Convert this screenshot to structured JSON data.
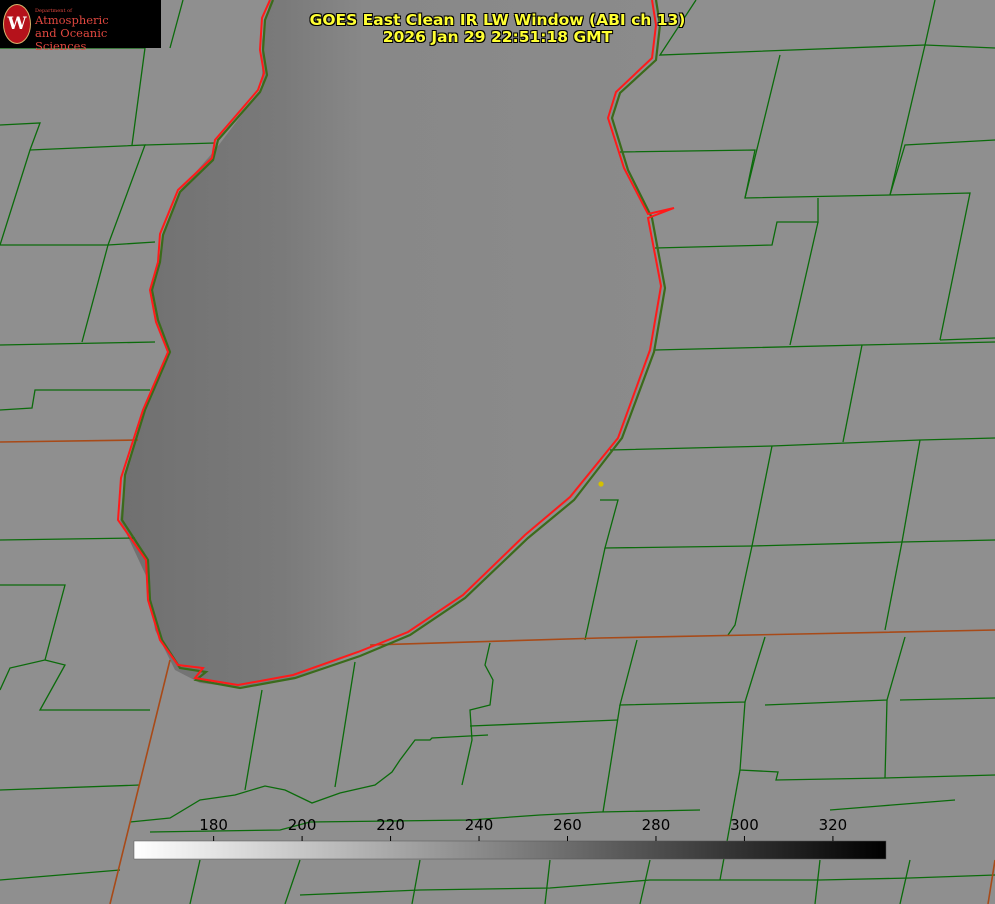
{
  "logo": {
    "dept": "Department of",
    "line1": "Atmospheric",
    "line2": "and Oceanic Sciences",
    "seal_letter": "W"
  },
  "title": {
    "line1": "GOES East Clean IR LW Window (ABI ch 13)",
    "line2": "2026 Jan 29 22:51:18 GMT"
  },
  "colorbar": {
    "ticks": [
      "180",
      "200",
      "220",
      "240",
      "260",
      "280",
      "300",
      "320"
    ],
    "range": [
      162,
      332
    ],
    "colormap": "white-to-black"
  },
  "colors": {
    "county_lines": "#0b6b0b",
    "state_lines": "#a84a18",
    "lake_outline": "#ff1a1a",
    "title_text": "#ffff33",
    "marker": "#d4c000",
    "land": "#8f8f8f",
    "lake_fill": "#888888"
  }
}
